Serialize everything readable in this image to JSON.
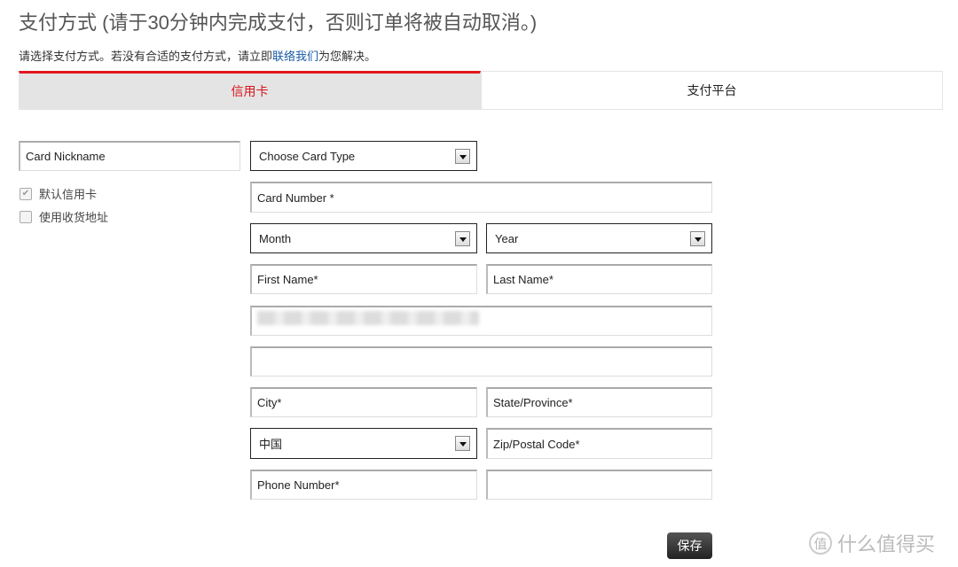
{
  "header": {
    "title": "支付方式 (请于30分钟内完成支付，否则订单将被自动取消。)",
    "subtitle_before": "请选择支付方式。若没有合适的支付方式，请立即",
    "contact_link": "联络我们",
    "subtitle_after": "为您解决。"
  },
  "tabs": [
    {
      "label": "信用卡",
      "active": true
    },
    {
      "label": "支付平台",
      "active": false
    }
  ],
  "form": {
    "card_nickname": "Card Nickname",
    "card_type": "Choose Card Type",
    "card_number": "Card Number *",
    "month": "Month",
    "year": "Year",
    "first_name": "First Name*",
    "last_name": "Last Name*",
    "address1": "",
    "address2": "",
    "city": "City*",
    "state": "State/Province*",
    "country": "中国",
    "zip": "Zip/Postal Code*",
    "phone": "Phone Number*",
    "extra": "",
    "default_card_label": "默认信用卡",
    "default_card_checked": true,
    "use_shipping_label": "使用收货地址",
    "use_shipping_checked": false,
    "save_label": "保存"
  },
  "watermark": {
    "icon": "值",
    "text": "什么值得买"
  },
  "colors": {
    "accent": "#e0161e",
    "link": "#1a5aa6"
  }
}
